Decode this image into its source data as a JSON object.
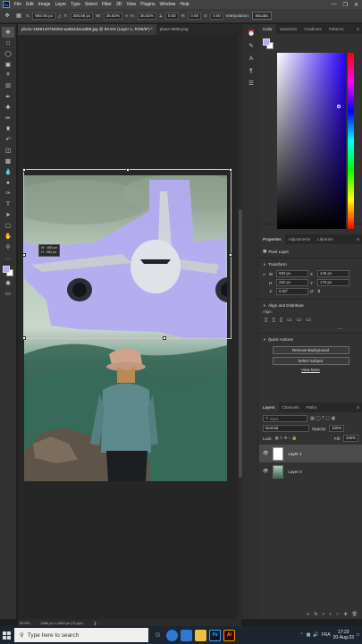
{
  "menubar": {
    "app_icon": "Ps",
    "items": [
      "File",
      "Edit",
      "Image",
      "Layer",
      "Type",
      "Select",
      "Filter",
      "3D",
      "View",
      "Plugins",
      "Window",
      "Help"
    ]
  },
  "options": {
    "x_label": "X:",
    "x_value": "893.06 px",
    "y_label": "Y:",
    "y_value": "305.58 px",
    "w_label": "W:",
    "w_value": "35.82%",
    "h_label": "H:",
    "h_value": "35.82%",
    "angle_value": "0.00",
    "hskew_label": "H:",
    "hskew_value": "0.00",
    "vskew_label": "V:",
    "vskew_value": "0.00",
    "interpolation_label": "Interpolation:",
    "interpolation_value": "Bicubic"
  },
  "tabs": [
    {
      "label": "photo-1689140762053-aa6643acad98.jpg @ 60.5% (Layer 1, RGB/8*) *"
    },
    {
      "label": "plane-9936.png"
    }
  ],
  "canvas": {
    "measure_w": "W : 893 px",
    "measure_h": "H : 262 px"
  },
  "status": {
    "zoom": "60.5%",
    "doc_size": "1080 px x 1580 px (72 ppi)"
  },
  "color_panel": {
    "tabs": [
      "Color",
      "Swatches",
      "Gradients",
      "Patterns"
    ]
  },
  "properties_panel": {
    "tabs": [
      "Properties",
      "Adjustments",
      "Libraries"
    ],
    "layer_kind": "Pixel Layer",
    "transform_title": "Transform",
    "w_label": "W",
    "w_value": "893 px",
    "h_label": "H",
    "h_value": "262 px",
    "x_label": "X",
    "x_value": "446 px",
    "y_label": "Y",
    "y_value": "175 px",
    "angle_value": "0.00°",
    "align_title": "Align and Distribute",
    "align_label": "Align:",
    "quick_actions_title": "Quick Actions",
    "remove_bg": "Remove Background",
    "select_subject": "Select Subject",
    "view_more": "View More"
  },
  "layers_panel": {
    "tabs": [
      "Layers",
      "Channels",
      "Paths"
    ],
    "kind_placeholder": "Kind",
    "blend_mode": "Normal",
    "opacity_label": "Opacity:",
    "opacity_value": "100%",
    "lock_label": "Lock:",
    "fill_label": "Fill:",
    "fill_value": "100%",
    "layers": [
      {
        "name": "Layer 1",
        "selected": true
      },
      {
        "name": "Layer 0",
        "selected": false
      }
    ]
  },
  "taskbar": {
    "search_placeholder": "Type here to search",
    "language": "FRA",
    "time": "17:23",
    "date": "20-Aug-23"
  },
  "colors": {
    "foreground": "#b3acf2",
    "background": "#ffffff",
    "selection_overlay": "#b3acf2",
    "ps_blue": "#31a8ff"
  }
}
